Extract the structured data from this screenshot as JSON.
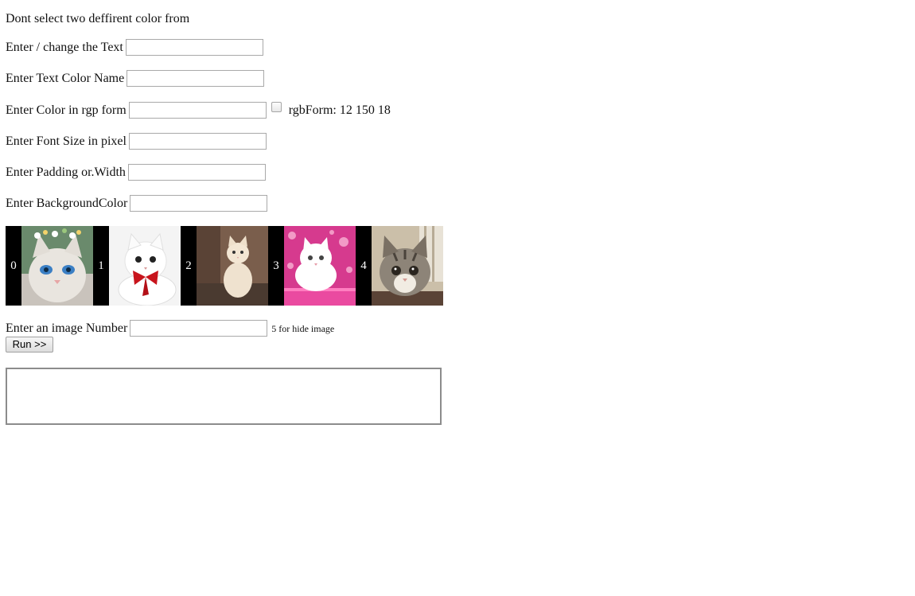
{
  "warning": "Dont select two deffirent color from",
  "fields": {
    "text_label": "Enter / change the Text",
    "text_value": "",
    "color_name_label": "Enter Text Color Name",
    "color_name_value": "",
    "rgb_label": "Enter Color in rgp form",
    "rgb_value": "",
    "rgb_form_note": "rgbForm: 12 150 18",
    "font_size_label": "Enter Font Size in pixel",
    "font_size_value": "",
    "padding_label": "Enter Padding or.Width",
    "padding_value": "",
    "bg_color_label": "Enter BackgroundColor",
    "bg_color_value": ""
  },
  "gallery": {
    "items": [
      {
        "number": "0",
        "icon": "white-kitten-blue-eyes-flower-crown"
      },
      {
        "number": "1",
        "icon": "white-kitten-red-bow"
      },
      {
        "number": "2",
        "icon": "cream-kitten-sitting"
      },
      {
        "number": "3",
        "icon": "white-kitten-pink-background"
      },
      {
        "number": "4",
        "icon": "tabby-kitten-closeup"
      }
    ]
  },
  "image_select": {
    "label": "Enter an image Number",
    "value": "",
    "hint": "5 for hide image"
  },
  "run_button": "Run >>",
  "output_text": "",
  "colors": {
    "label_text": "#111111",
    "border": "#a9a9a9",
    "number_bg": "#000000",
    "number_text": "#ffffff"
  }
}
